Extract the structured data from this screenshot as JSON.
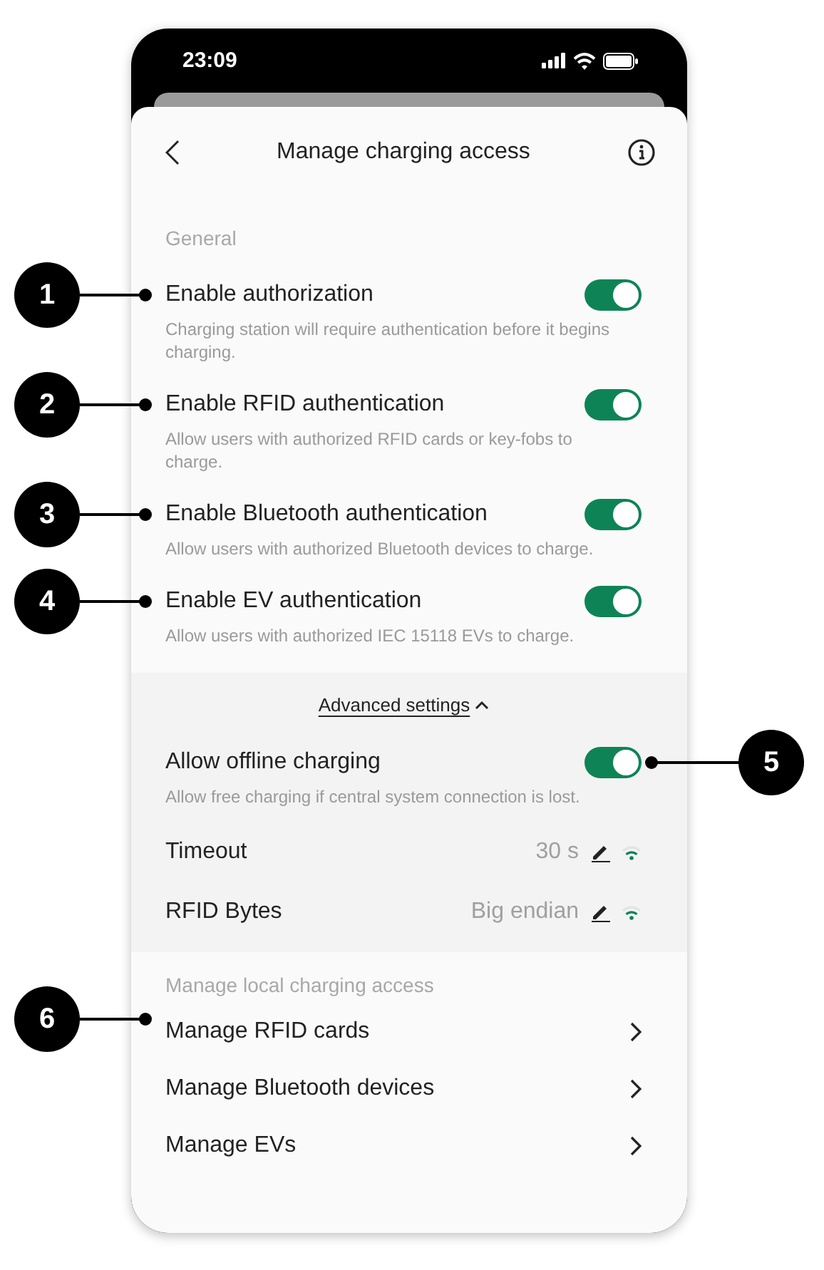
{
  "status_bar": {
    "time": "23:09"
  },
  "header": {
    "title": "Manage charging access"
  },
  "general": {
    "heading": "General",
    "items": [
      {
        "title": "Enable authorization",
        "description": "Charging station will require authentication before it begins charging.",
        "on": true,
        "callout": "1"
      },
      {
        "title": "Enable RFID authentication",
        "description": "Allow users with authorized RFID cards or key-fobs to charge.",
        "on": true,
        "callout": "2"
      },
      {
        "title": "Enable Bluetooth authentication",
        "description": "Allow users with authorized Bluetooth devices to charge.",
        "on": true,
        "callout": "3"
      },
      {
        "title": "Enable EV authentication",
        "description": "Allow users with authorized IEC 15118 EVs to charge.",
        "on": true,
        "callout": "4"
      }
    ]
  },
  "advanced": {
    "toggle_label": "Advanced settings",
    "expanded": true,
    "items": [
      {
        "kind": "toggle",
        "title": "Allow offline charging",
        "description": "Allow free charging if central system connection is lost.",
        "on": true,
        "callout": "5",
        "callout_right": true
      },
      {
        "kind": "value",
        "title": "Timeout",
        "value": "30 s"
      },
      {
        "kind": "value",
        "title": "RFID Bytes",
        "value": "Big endian"
      }
    ]
  },
  "local": {
    "heading": "Manage local charging access",
    "callout": "6",
    "items": [
      {
        "label": "Manage RFID cards"
      },
      {
        "label": "Manage Bluetooth devices"
      },
      {
        "label": "Manage EVs"
      }
    ]
  }
}
